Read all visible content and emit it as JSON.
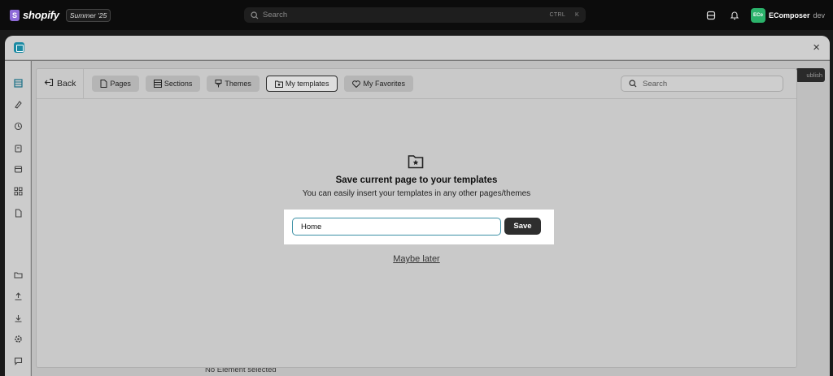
{
  "topbar": {
    "brand": "shopify",
    "brand_icon_letter": "S",
    "edition": "Summer '25",
    "search_placeholder": "Search",
    "shortcut_ctrl": "CTRL",
    "shortcut_key": "K",
    "store_avatar": "ECo",
    "store_name": "EComposer",
    "store_tag": "dev"
  },
  "app": {
    "close_glyph": "×",
    "publish_stub": "ublish",
    "status_text": "No Element selected"
  },
  "modal": {
    "back_label": "Back",
    "tabs": [
      {
        "label": "Pages",
        "icon": "page-icon"
      },
      {
        "label": "Sections",
        "icon": "sections-icon"
      },
      {
        "label": "Themes",
        "icon": "brush-icon"
      },
      {
        "label": "My templates",
        "icon": "folder-star-icon",
        "active": true
      },
      {
        "label": "My Favorites",
        "icon": "heart-icon"
      }
    ],
    "search_placeholder": "Search",
    "title": "Save current page to your templates",
    "subtitle": "You can easily insert your templates in any other pages/themes",
    "name_value": "Home",
    "save_label": "Save",
    "maybe_later": "Maybe later"
  },
  "colors": {
    "topbar": "#0c0c0c",
    "brand_purple": "#8e6bd8",
    "store_green": "#2bb36b",
    "app_teal": "#1a8aa3",
    "input_border": "#3b8fa5",
    "save_button": "#2e2e2e"
  }
}
